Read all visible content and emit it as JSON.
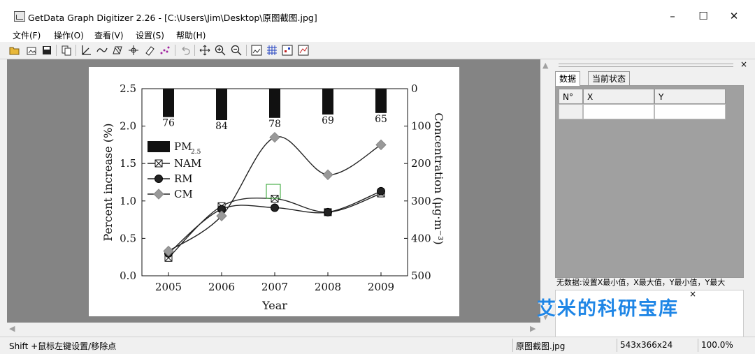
{
  "window": {
    "title": "GetData Graph Digitizer 2.26 - [C:\\Users\\Jim\\Desktop\\原图截图.jpg]",
    "min": "–",
    "max": "☐",
    "close": "✕"
  },
  "menu": [
    "文件(F)",
    "操作(O)",
    "查看(V)",
    "设置(S)",
    "帮助(H)"
  ],
  "toolbar_icons": [
    "open-icon",
    "open-image-icon",
    "save-icon",
    "copy-icon",
    "axis-icon",
    "line-digitize-icon",
    "area-icon",
    "point-icon",
    "eraser-icon",
    "auto-trace-icon",
    "undo-icon",
    "move-icon",
    "zoom-in-icon",
    "zoom-out-icon",
    "fit-image-icon",
    "grid-icon",
    "points-icon",
    "show-graph-icon"
  ],
  "chart_data": {
    "type": "line",
    "categories": [
      "2005",
      "2006",
      "2007",
      "2008",
      "2009"
    ],
    "xlabel": "Year",
    "ylabel": "Percent increase (%)",
    "y2label": "Concentration (μg·m⁻³)",
    "ylim": [
      0,
      2.5
    ],
    "y_ticks": [
      "0.0",
      "0.5",
      "1.0",
      "1.5",
      "2.0",
      "2.5"
    ],
    "y2lim": [
      0,
      500
    ],
    "y2_ticks": [
      "0",
      "100",
      "200",
      "300",
      "400",
      "500"
    ],
    "bars": {
      "name": "PM2.5",
      "values": [
        76,
        84,
        78,
        69,
        65
      ],
      "labels": [
        "76",
        "84",
        "78",
        "69",
        "65"
      ]
    },
    "series": [
      {
        "name": "NAM",
        "values": [
          0.24,
          0.93,
          1.03,
          0.85,
          1.1
        ]
      },
      {
        "name": "RM",
        "values": [
          0.3,
          0.89,
          0.91,
          0.85,
          1.13
        ]
      },
      {
        "name": "CM",
        "values": [
          0.33,
          0.8,
          1.85,
          1.35,
          1.75
        ]
      }
    ],
    "legend": [
      "PM2.5",
      "NAM",
      "RM",
      "CM"
    ],
    "legend_position": "upper-left"
  },
  "panel": {
    "tabs": [
      "数据",
      "当前状态"
    ],
    "columns": [
      "N°",
      "X",
      "Y"
    ],
    "status": "无数据:设置X最小值，X最大值，Y最小值，Y最大",
    "close": "×"
  },
  "statusbar": {
    "hint": "Shift +鼠标左键设置/移除点",
    "file": "原图截图.jpg",
    "size": "543x366x24",
    "zoom": "100.0%"
  },
  "watermark": "艾米的科研宝库",
  "watermark_close": "×"
}
